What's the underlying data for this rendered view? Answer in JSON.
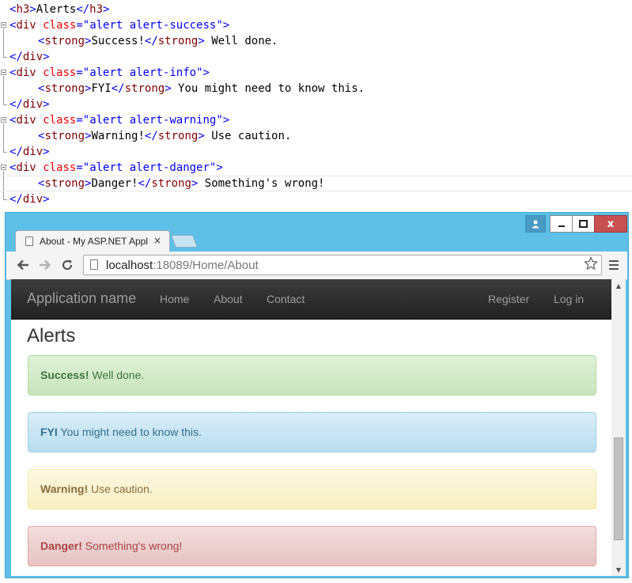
{
  "editor": {
    "lines": [
      {
        "open": "<",
        "tag": "h3",
        "close": ">",
        "text": "Alerts",
        "end_open": "</",
        "end_tag": "h3",
        "end_close": ">"
      },
      {
        "open": "<",
        "tag": "div",
        "attr": "class",
        "eq": "=",
        "val": "\"alert alert-success\"",
        "close": ">"
      },
      {
        "open": "<",
        "tag": "strong",
        "close": ">",
        "label": "Success!",
        "end_open": "</",
        "end_tag": "strong",
        "end_close": ">",
        "rest": " Well done."
      },
      {
        "open": "</",
        "tag": "div",
        "close": ">"
      },
      {
        "open": "<",
        "tag": "div",
        "attr": "class",
        "eq": "=",
        "val": "\"alert alert-info\"",
        "close": ">"
      },
      {
        "open": "<",
        "tag": "strong",
        "close": ">",
        "label": "FYI",
        "end_open": "</",
        "end_tag": "strong",
        "end_close": ">",
        "rest": " You might need to know this."
      },
      {
        "open": "</",
        "tag": "div",
        "close": ">"
      },
      {
        "open": "<",
        "tag": "div",
        "attr": "class",
        "eq": "=",
        "val": "\"alert alert-warning\"",
        "close": ">"
      },
      {
        "open": "<",
        "tag": "strong",
        "close": ">",
        "label": "Warning!",
        "end_open": "</",
        "end_tag": "strong",
        "end_close": ">",
        "rest": " Use caution."
      },
      {
        "open": "</",
        "tag": "div",
        "close": ">"
      },
      {
        "open": "<",
        "tag": "div",
        "attr": "class",
        "eq": "=",
        "val": "\"alert alert-danger\"",
        "close": ">"
      },
      {
        "open": "<",
        "tag": "strong",
        "close": ">",
        "label": "Danger!",
        "end_open": "</",
        "end_tag": "strong",
        "end_close": ">",
        "rest": " Something's wrong!"
      },
      {
        "open": "</",
        "tag": "div",
        "close": ">"
      }
    ]
  },
  "browser": {
    "tab_title": "About - My ASP.NET Appl",
    "tab_close": "×",
    "url_host": "localhost",
    "url_rest": ":18089/Home/About",
    "icons": {
      "back": "back-arrow-icon",
      "forward": "forward-arrow-icon",
      "reload": "reload-icon",
      "star": "star-icon",
      "menu": "menu-icon",
      "user": "user-icon",
      "minimize": "minimize-icon",
      "maximize": "maximize-icon",
      "close": "close-icon"
    },
    "close_glyph": "x"
  },
  "site": {
    "brand": "Application name",
    "nav_left": [
      "Home",
      "About",
      "Contact"
    ],
    "nav_right": [
      "Register",
      "Log in"
    ],
    "heading": "Alerts",
    "alerts": [
      {
        "type": "success",
        "strong": "Success!",
        "text": " Well done."
      },
      {
        "type": "info",
        "strong": "FYI",
        "text": " You might need to know this."
      },
      {
        "type": "warning",
        "strong": "Warning!",
        "text": " Use caution."
      },
      {
        "type": "danger",
        "strong": "Danger!",
        "text": " Something's wrong!"
      }
    ]
  },
  "colors": {
    "window_frame": "#5ec0e6",
    "close_button": "#c75050",
    "navbar": "#222222",
    "success": "#3c763d",
    "info": "#31708f",
    "warning": "#8a6d3b",
    "danger": "#a94442"
  }
}
